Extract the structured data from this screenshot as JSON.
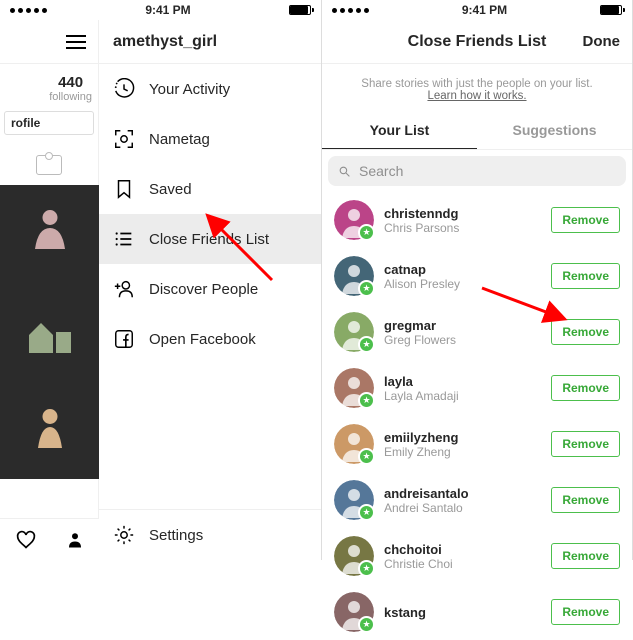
{
  "status": {
    "time": "9:41 PM"
  },
  "left": {
    "username": "amethyst_girl",
    "following_count": "440",
    "following_label": "following",
    "profile_btn": "rofile",
    "menu": {
      "activity": "Your Activity",
      "nametag": "Nametag",
      "saved": "Saved",
      "close_friends": "Close Friends List",
      "discover": "Discover People",
      "facebook": "Open Facebook",
      "settings": "Settings"
    }
  },
  "right": {
    "title": "Close Friends List",
    "done": "Done",
    "desc": "Share stories with just the people on your list.",
    "learn": "Learn how it works.",
    "tabs": {
      "your_list": "Your List",
      "suggestions": "Suggestions"
    },
    "search_placeholder": "Search",
    "remove_label": "Remove",
    "friends": [
      {
        "username": "christenndg",
        "fullname": "Chris Parsons"
      },
      {
        "username": "catnap",
        "fullname": "Alison Presley"
      },
      {
        "username": "gregmar",
        "fullname": "Greg Flowers"
      },
      {
        "username": "layla",
        "fullname": "Layla Amadaji"
      },
      {
        "username": "emiilyzheng",
        "fullname": "Emily Zheng"
      },
      {
        "username": "andreisantalo",
        "fullname": "Andrei Santalo"
      },
      {
        "username": "chchoitoi",
        "fullname": "Christie Choi"
      },
      {
        "username": "kstang",
        "fullname": ""
      }
    ]
  },
  "colors": {
    "accent_green": "#4cbf4c",
    "arrow_red": "#ff0000"
  }
}
